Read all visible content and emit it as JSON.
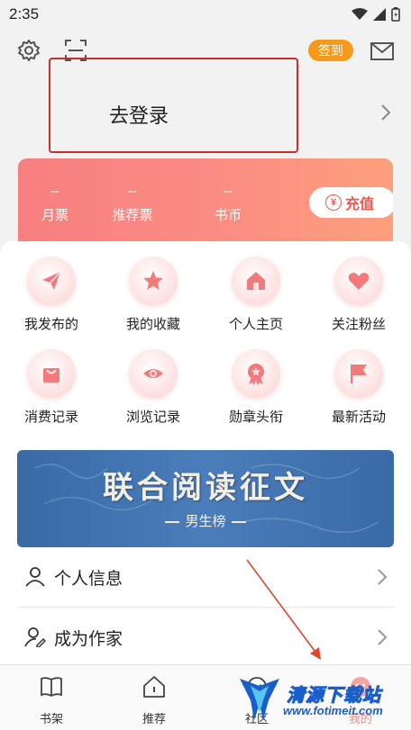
{
  "status_bar": {
    "time": "2:35"
  },
  "header": {
    "signin_label": "签到"
  },
  "login": {
    "label": "去登录"
  },
  "tickets": {
    "items": [
      {
        "value": "--",
        "label": "月票"
      },
      {
        "value": "--",
        "label": "推荐票"
      },
      {
        "value": "--",
        "label": "书币"
      }
    ],
    "recharge_symbol": "¥",
    "recharge_label": "充值"
  },
  "grid": [
    {
      "label": "我发布的",
      "icon": "send-icon"
    },
    {
      "label": "我的收藏",
      "icon": "star-icon"
    },
    {
      "label": "个人主页",
      "icon": "home-icon"
    },
    {
      "label": "关注粉丝",
      "icon": "heart-icon"
    },
    {
      "label": "消费记录",
      "icon": "bag-icon"
    },
    {
      "label": "浏览记录",
      "icon": "eye-icon"
    },
    {
      "label": "勋章头衔",
      "icon": "medal-icon"
    },
    {
      "label": "最新活动",
      "icon": "flag-icon"
    }
  ],
  "banner": {
    "title": "联合阅读征文",
    "subtitle": "男生榜"
  },
  "menu": [
    {
      "label": "个人信息",
      "icon": "person-icon"
    },
    {
      "label": "成为作家",
      "icon": "person-edit-icon"
    }
  ],
  "tabs": [
    {
      "label": "书架",
      "icon": "book-icon"
    },
    {
      "label": "推荐",
      "icon": "recommend-icon"
    },
    {
      "label": "社区",
      "icon": "community-icon"
    },
    {
      "label": "我的",
      "icon": "mine-icon",
      "active": true
    }
  ],
  "watermark": {
    "text": "清源下载站",
    "url": "www.fotimeit.com"
  },
  "colors": {
    "accent": "#f59a1d",
    "brand_pink": "#f77f80",
    "highlight_red": "#c9302c"
  }
}
